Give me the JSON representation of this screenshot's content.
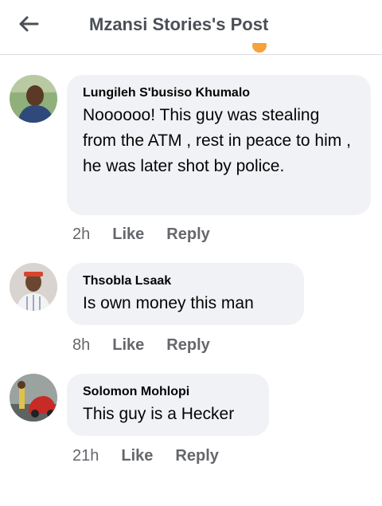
{
  "header": {
    "title": "Mzansi Stories's Post"
  },
  "comments": [
    {
      "author": "Lungileh S'busiso Khumalo",
      "text": "Noooooo! This guy was stealing from the ATM , rest in peace to him , he was later shot by police.",
      "time": "2h",
      "like_label": "Like",
      "reply_label": "Reply"
    },
    {
      "author": "Thsobla Lsaak",
      "text": "Is own money this man",
      "time": "8h",
      "like_label": "Like",
      "reply_label": "Reply"
    },
    {
      "author": "Solomon Mohlopi",
      "text": "This guy is a Hecker",
      "time": "21h",
      "like_label": "Like",
      "reply_label": "Reply"
    }
  ],
  "colors": {
    "bubble": "#f0f2f5",
    "title": "#4b4f56",
    "meta": "#65676b"
  }
}
